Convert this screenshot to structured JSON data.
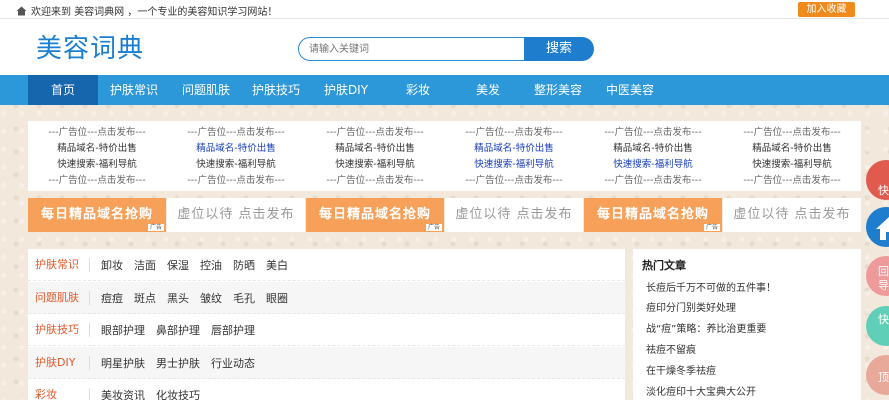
{
  "topbar": {
    "welcome": "欢迎来到 美容词典网 ，一个专业的美容知识学习网站！",
    "fav": "加入收藏"
  },
  "header": {
    "logo": "美容词典",
    "search_placeholder": "请输入关键词",
    "search_btn": "搜索"
  },
  "nav": [
    "首页",
    "护肤常识",
    "问题肌肤",
    "护肤技巧",
    "护肤DIY",
    "彩妆",
    "美发",
    "整形美容",
    "中医美容"
  ],
  "ads": {
    "dash": "---广告位---点击发布---",
    "cols": [
      {
        "l1": "精品域名-特价出售",
        "l2": "快速搜索-福利导航",
        "blue": false
      },
      {
        "l1": "精品域名-特价出售",
        "l2": "快速搜索-福利导航",
        "blue": true
      },
      {
        "l1": "精品域名-特价出售",
        "l2": "快速搜索-福利导航",
        "blue": false
      },
      {
        "l1": "精品域名-特价出售",
        "l2": "快速搜索-福利导航",
        "blue": true
      },
      {
        "l1": "精品域名-特价出售",
        "l2": "快速搜索-福利导航",
        "blue": false
      },
      {
        "l1": "精品域名-特价出售",
        "l2": "快速搜索-福利导航",
        "blue": false
      }
    ]
  },
  "banners": {
    "orange": "每日精品域名抢购",
    "white": "虚位以待 点击发布",
    "badge": "广告"
  },
  "categories": [
    {
      "title": "护肤常识",
      "links": [
        "卸妆",
        "洁面",
        "保湿",
        "控油",
        "防晒",
        "美白"
      ]
    },
    {
      "title": "问题肌肤",
      "links": [
        "痘痘",
        "斑点",
        "黑头",
        "皱纹",
        "毛孔",
        "眼圈"
      ]
    },
    {
      "title": "护肤技巧",
      "links": [
        "眼部护理",
        "鼻部护理",
        "唇部护理"
      ]
    },
    {
      "title": "护肤DIY",
      "links": [
        "明星护肤",
        "男士护肤",
        "行业动态"
      ]
    },
    {
      "title": "彩妆",
      "links": [
        "美妆资讯",
        "化妆技巧"
      ]
    }
  ],
  "hot": {
    "title": "热门文章",
    "items": [
      "长痘后千万不可做的五件事！",
      "痘印分门别类好处理",
      "战“痘”策略：养比治更重要",
      "祛痘不留痕",
      "在干燥冬季祛痘",
      "淡化痘印十大宝典大公开"
    ]
  },
  "floats": [
    "快",
    "回",
    "导",
    "快",
    "顶"
  ],
  "colors": {
    "nav": "#2c97d9",
    "nav_active": "#1566ad",
    "accent": "#f08a1c",
    "logo": "#1a7fd1"
  }
}
